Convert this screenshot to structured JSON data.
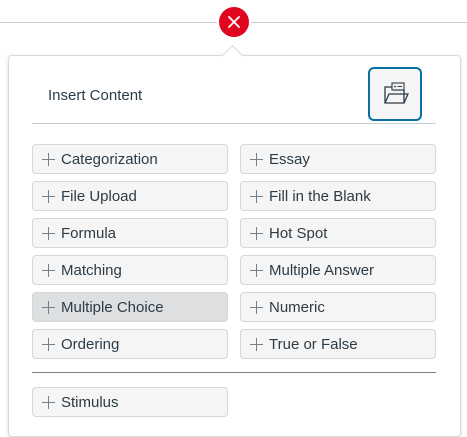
{
  "panel": {
    "title": "Insert Content"
  },
  "question_types": [
    {
      "label": "Categorization",
      "selected": false
    },
    {
      "label": "Essay",
      "selected": false
    },
    {
      "label": "File Upload",
      "selected": false
    },
    {
      "label": "Fill in the Blank",
      "selected": false
    },
    {
      "label": "Formula",
      "selected": false
    },
    {
      "label": "Hot Spot",
      "selected": false
    },
    {
      "label": "Matching",
      "selected": false
    },
    {
      "label": "Multiple Answer",
      "selected": false
    },
    {
      "label": "Multiple Choice",
      "selected": true
    },
    {
      "label": "Numeric",
      "selected": false
    },
    {
      "label": "Ordering",
      "selected": false
    },
    {
      "label": "True or False",
      "selected": false
    }
  ],
  "stimulus": {
    "label": "Stimulus"
  },
  "icons": {
    "close": "close-icon",
    "folder": "open-folder-icon",
    "plus": "plus-icon"
  },
  "colors": {
    "close_red": "#e0061f",
    "focus_blue": "#0770a3",
    "button_bg": "#f5f5f5",
    "selected_bg": "#dddfe1",
    "text": "#2d3b45"
  }
}
